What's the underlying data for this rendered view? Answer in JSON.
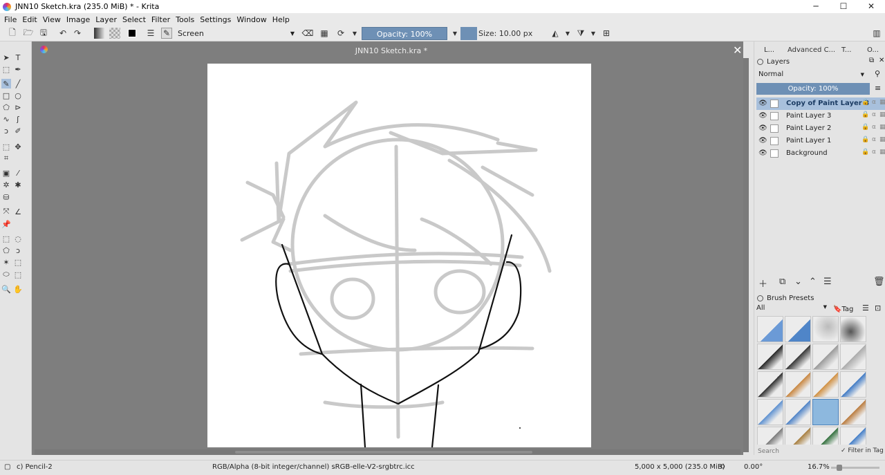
{
  "window": {
    "title": "JNN10 Sketch.kra (235.0 MiB)  * - Krita"
  },
  "window_controls": {
    "minimize": "─",
    "maximize": "☐",
    "close": "✕"
  },
  "menu": [
    "File",
    "Edit",
    "View",
    "Image",
    "Layer",
    "Select",
    "Filter",
    "Tools",
    "Settings",
    "Window",
    "Help"
  ],
  "toolbar": {
    "blend_mode": "Screen",
    "opacity": "Opacity: 100%",
    "size": "Size: 10.00 px"
  },
  "document": {
    "tab_title": "JNN10 Sketch.kra *",
    "close_symbol": "✕"
  },
  "docker_tabs": [
    "L...",
    "Advanced C...",
    "T...",
    "O..."
  ],
  "layers_panel": {
    "title": "Layers",
    "blend_mode": "Normal",
    "opacity": "Opacity:  100%",
    "layers": [
      {
        "name": "Copy of Paint Layer 3",
        "selected": true
      },
      {
        "name": "Paint Layer 3",
        "selected": false
      },
      {
        "name": "Paint Layer 2",
        "selected": false
      },
      {
        "name": "Paint Layer 1",
        "selected": false
      },
      {
        "name": "Background",
        "selected": false
      }
    ]
  },
  "brush_presets": {
    "title": "Brush Presets",
    "filter": "All",
    "tag_label": "Tag",
    "search_placeholder": "Search",
    "filter_in_tag": "Filter in Tag"
  },
  "status": {
    "brush": "c) Pencil-2",
    "color_space": "RGB/Alpha (8-bit integer/channel)  sRGB-elle-V2-srgbtrc.icc",
    "image_size": "5,000 x 5,000 (235.0 MiB)",
    "rotation": "0.00°",
    "zoom": "16.7%"
  },
  "colors": {
    "accent": "#6e90b5",
    "canvas_bg": "#7e7e7e",
    "selected_layer": "#a8c0dc"
  }
}
